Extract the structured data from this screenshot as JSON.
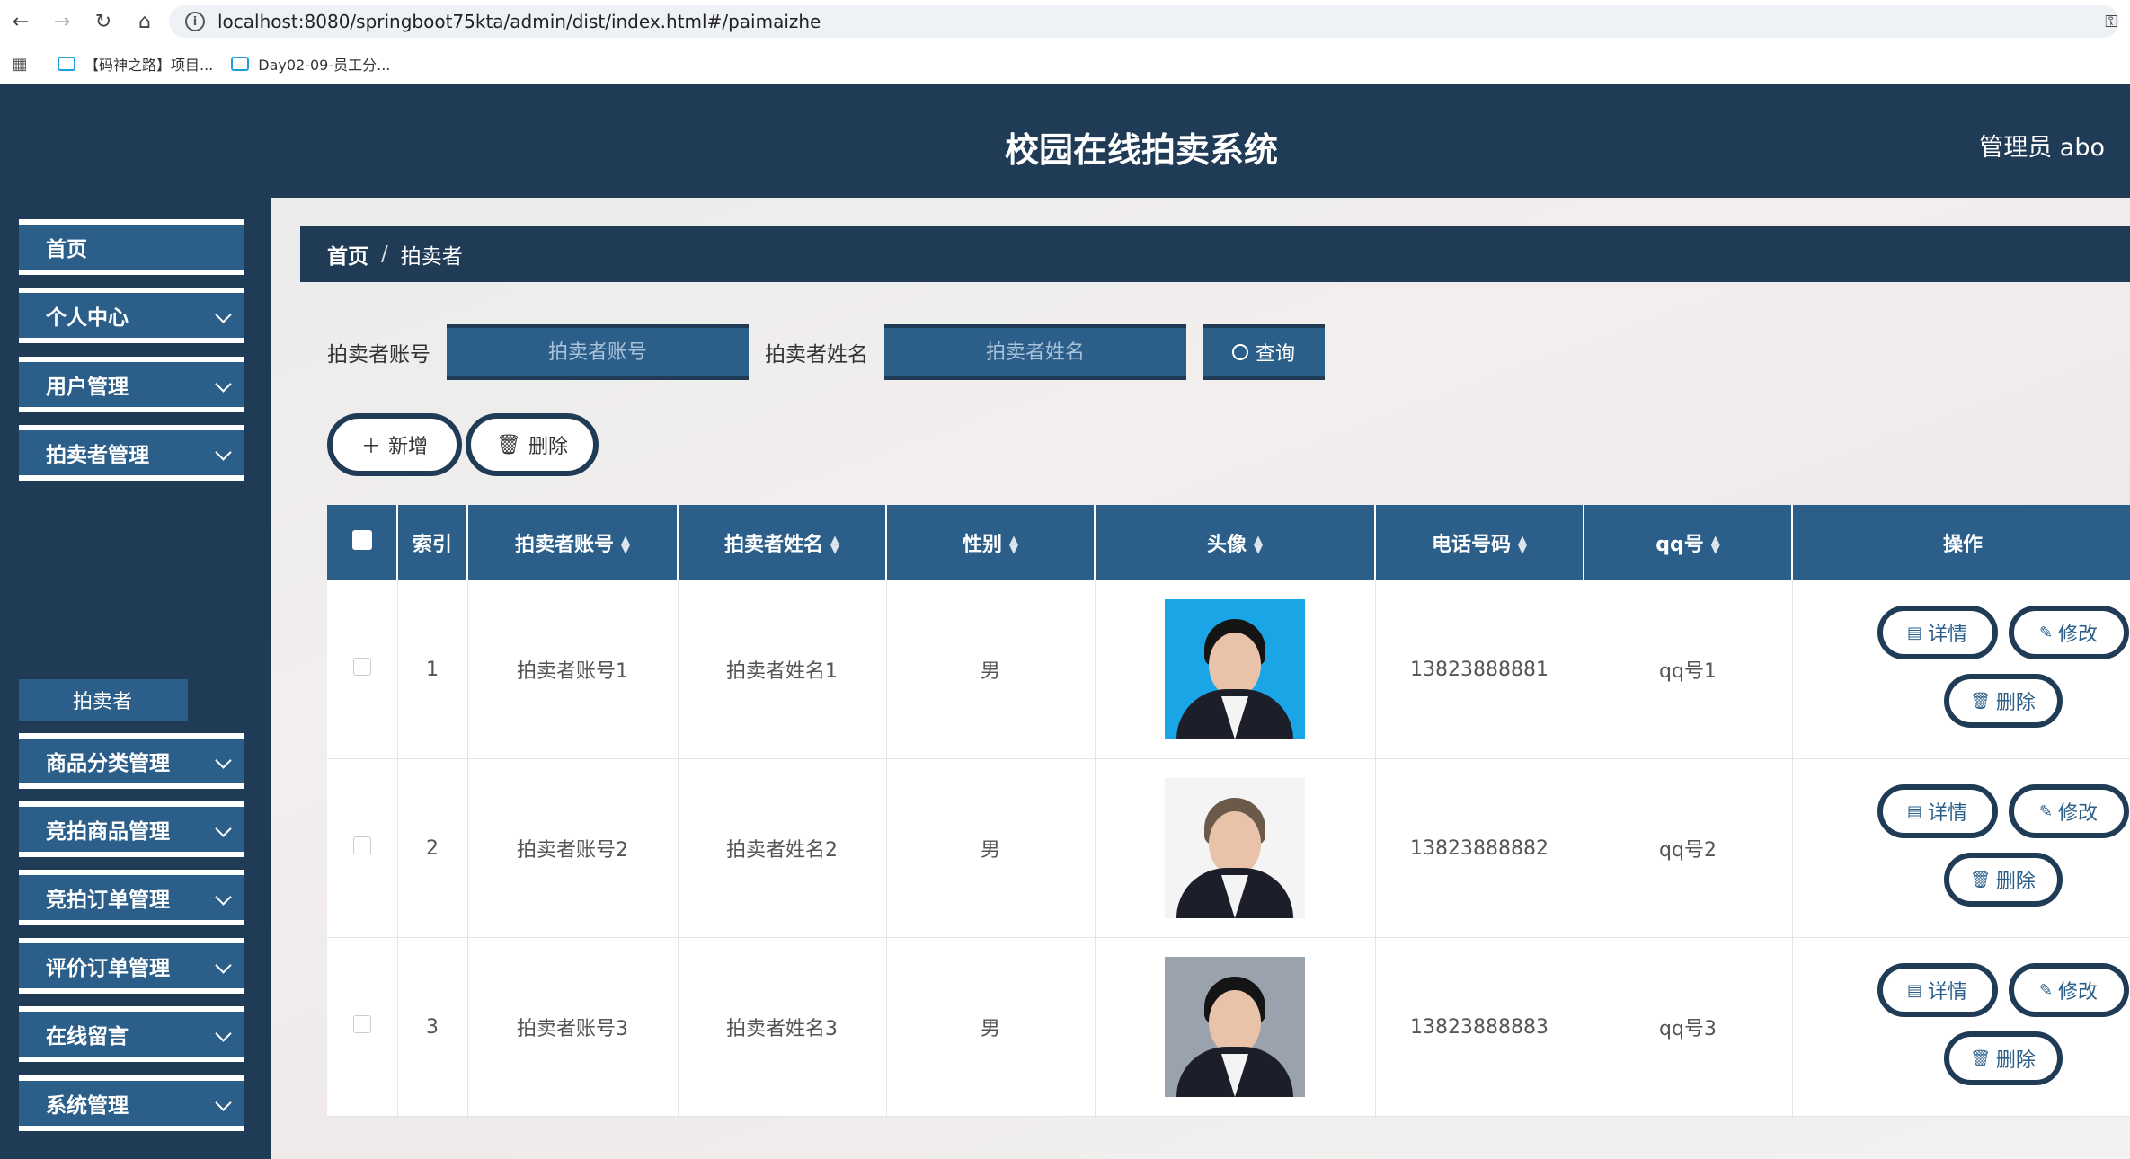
{
  "browser": {
    "url": "localhost:8080/springboot75kta/admin/dist/index.html#/paimaizhe",
    "bookmarks": [
      "【码神之路】项目...",
      "Day02-09-员工分..."
    ]
  },
  "header": {
    "title": "校园在线拍卖系统",
    "user": "管理员 abo"
  },
  "sidebar": {
    "items": [
      {
        "label": "首页",
        "has_children": false
      },
      {
        "label": "个人中心",
        "has_children": true
      },
      {
        "label": "用户管理",
        "has_children": true
      },
      {
        "label": "拍卖者管理",
        "has_children": true
      },
      {
        "label": "商品分类管理",
        "has_children": true
      },
      {
        "label": "竞拍商品管理",
        "has_children": true
      },
      {
        "label": "竞拍订单管理",
        "has_children": true
      },
      {
        "label": "评价订单管理",
        "has_children": true
      },
      {
        "label": "在线留言",
        "has_children": true
      },
      {
        "label": "系统管理",
        "has_children": true
      }
    ],
    "active_sub": "拍卖者"
  },
  "breadcrumb": {
    "home": "首页",
    "separator": "/",
    "current": "拍卖者"
  },
  "search": {
    "account_label": "拍卖者账号",
    "account_placeholder": "拍卖者账号",
    "name_label": "拍卖者姓名",
    "name_placeholder": "拍卖者姓名",
    "query_label": "查询"
  },
  "actions": {
    "add_label": "新增",
    "delete_label": "删除"
  },
  "table": {
    "columns": [
      "索引",
      "拍卖者账号",
      "拍卖者姓名",
      "性别",
      "头像",
      "电话号码",
      "qq号",
      "操作"
    ],
    "rows": [
      {
        "index": "1",
        "account": "拍卖者账号1",
        "name": "拍卖者姓名1",
        "gender": "男",
        "phone": "13823888881",
        "qq": "qq号1"
      },
      {
        "index": "2",
        "account": "拍卖者账号2",
        "name": "拍卖者姓名2",
        "gender": "男",
        "phone": "13823888882",
        "qq": "qq号2"
      },
      {
        "index": "3",
        "account": "拍卖者账号3",
        "name": "拍卖者姓名3",
        "gender": "男",
        "phone": "13823888883",
        "qq": "qq号3"
      }
    ],
    "row_actions": {
      "detail": "详情",
      "edit": "修改",
      "delete": "删除"
    }
  },
  "icons": {
    "back": "arrow-left-icon",
    "forward": "arrow-right-icon",
    "reload": "reload-icon",
    "home": "home-icon",
    "apps": "apps-grid-icon"
  },
  "colors": {
    "primary_dark": "#1f3b55",
    "primary": "#2b5f8a"
  }
}
